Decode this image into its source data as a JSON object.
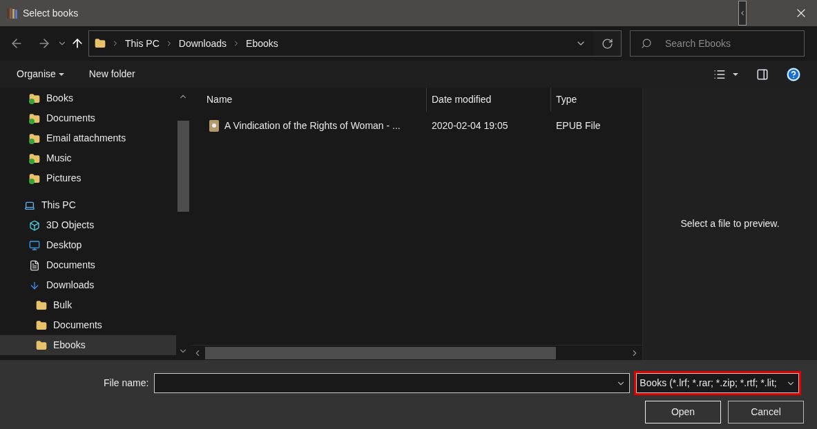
{
  "window": {
    "title": "Select books"
  },
  "breadcrumb": [
    "This PC",
    "Downloads",
    "Ebooks"
  ],
  "search": {
    "placeholder": "Search Ebooks"
  },
  "toolbar": {
    "organise": "Organise",
    "new_folder": "New folder"
  },
  "sidebar": {
    "items": [
      {
        "label": "Books",
        "kind": "synced-folder",
        "selected": false
      },
      {
        "label": "Documents",
        "kind": "synced-folder",
        "selected": false
      },
      {
        "label": "Email attachments",
        "kind": "synced-folder",
        "selected": false
      },
      {
        "label": "Music",
        "kind": "synced-folder",
        "selected": false
      },
      {
        "label": "Pictures",
        "kind": "synced-folder",
        "selected": false
      },
      {
        "label": "This PC",
        "kind": "pc",
        "selected": false,
        "children": [
          {
            "label": "3D Objects",
            "kind": "cube",
            "selected": false
          },
          {
            "label": "Desktop",
            "kind": "desktop",
            "selected": false
          },
          {
            "label": "Documents",
            "kind": "document",
            "selected": false
          },
          {
            "label": "Downloads",
            "kind": "download",
            "selected": false,
            "children": [
              {
                "label": "Bulk",
                "kind": "folder",
                "selected": false
              },
              {
                "label": "Documents",
                "kind": "folder",
                "selected": false
              },
              {
                "label": "Ebooks",
                "kind": "folder",
                "selected": true
              }
            ]
          }
        ]
      }
    ]
  },
  "table": {
    "columns": [
      "Name",
      "Date modified",
      "Type"
    ],
    "rows": [
      {
        "name": "A Vindication of the Rights of Woman - ...",
        "date": "2020-02-04 19:05",
        "type": "EPUB File",
        "selected": false
      }
    ]
  },
  "preview": {
    "message": "Select a file to preview."
  },
  "footer": {
    "file_name_label": "File name:",
    "file_type": {
      "value": "Books (*.lrf; *.rar; *.zip; *.rtf; *.lit;",
      "highlighted": true
    },
    "buttons": [
      "Open",
      "Cancel"
    ]
  }
}
